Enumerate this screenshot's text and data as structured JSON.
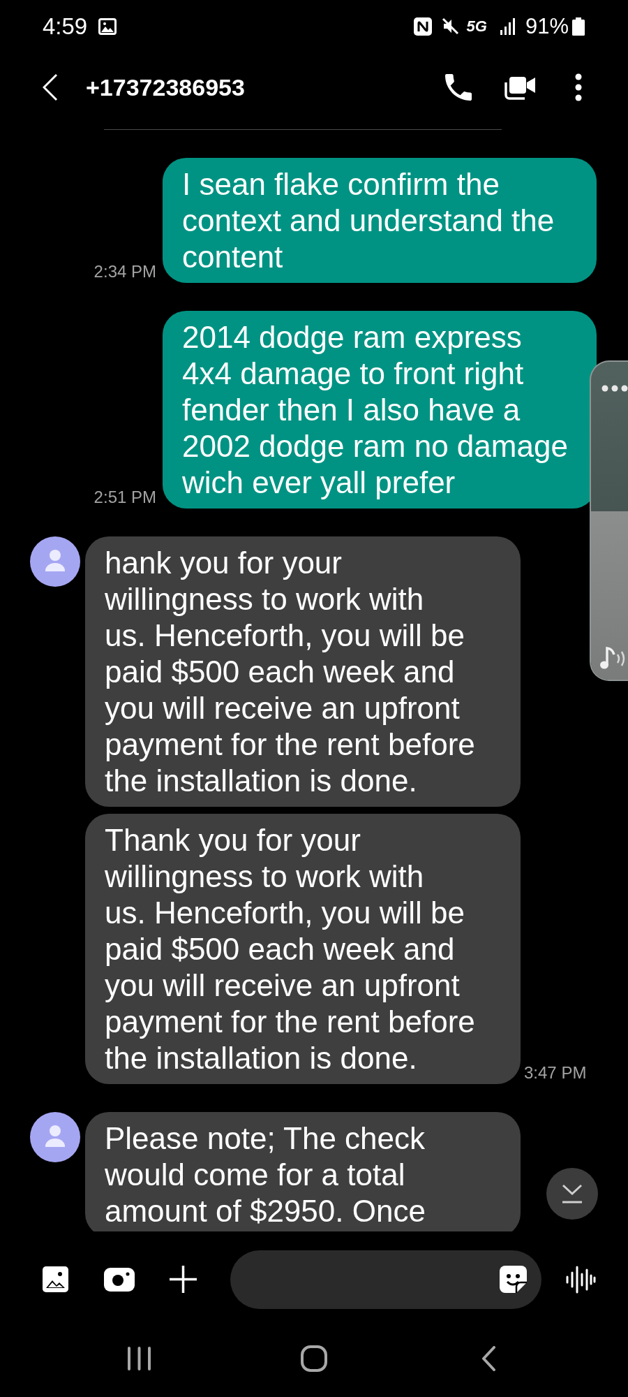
{
  "status_bar": {
    "time": "4:59",
    "network": "5G",
    "battery": "91%"
  },
  "header": {
    "title": "+17372386953"
  },
  "messages": [
    {
      "kind": "sent",
      "avatar": false,
      "lines": [
        "I sean flake confirm the",
        "context and understand the",
        "content"
      ],
      "time": "2:34 PM"
    },
    {
      "kind": "sent",
      "avatar": false,
      "lines": [
        "2014 dodge ram express",
        "4x4 damage to front right",
        "fender then I also have a",
        "2002 dodge ram no damage",
        "wich ever yall prefer"
      ],
      "time": "2:51 PM"
    },
    {
      "kind": "received",
      "avatar": true,
      "lines": [
        "hank you for your",
        "willingness to work with",
        "us. Henceforth, you will be",
        "paid $500 each week and",
        "you will receive an upfront",
        "payment for the rent before",
        "the installation is done."
      ]
    },
    {
      "kind": "received",
      "avatar": false,
      "lines": [
        "Thank you for your",
        "willingness to work with",
        "us. Henceforth, you will be",
        "paid $500 each week and",
        "you will receive an upfront",
        "payment for the rent before",
        "the installation is done."
      ],
      "time": "3:47 PM"
    },
    {
      "kind": "received",
      "avatar": true,
      "lines": [
        "Please note; The check",
        "would come for a total",
        "amount of $2950. Once"
      ]
    }
  ],
  "volume_panel": {
    "level": 0.53
  }
}
